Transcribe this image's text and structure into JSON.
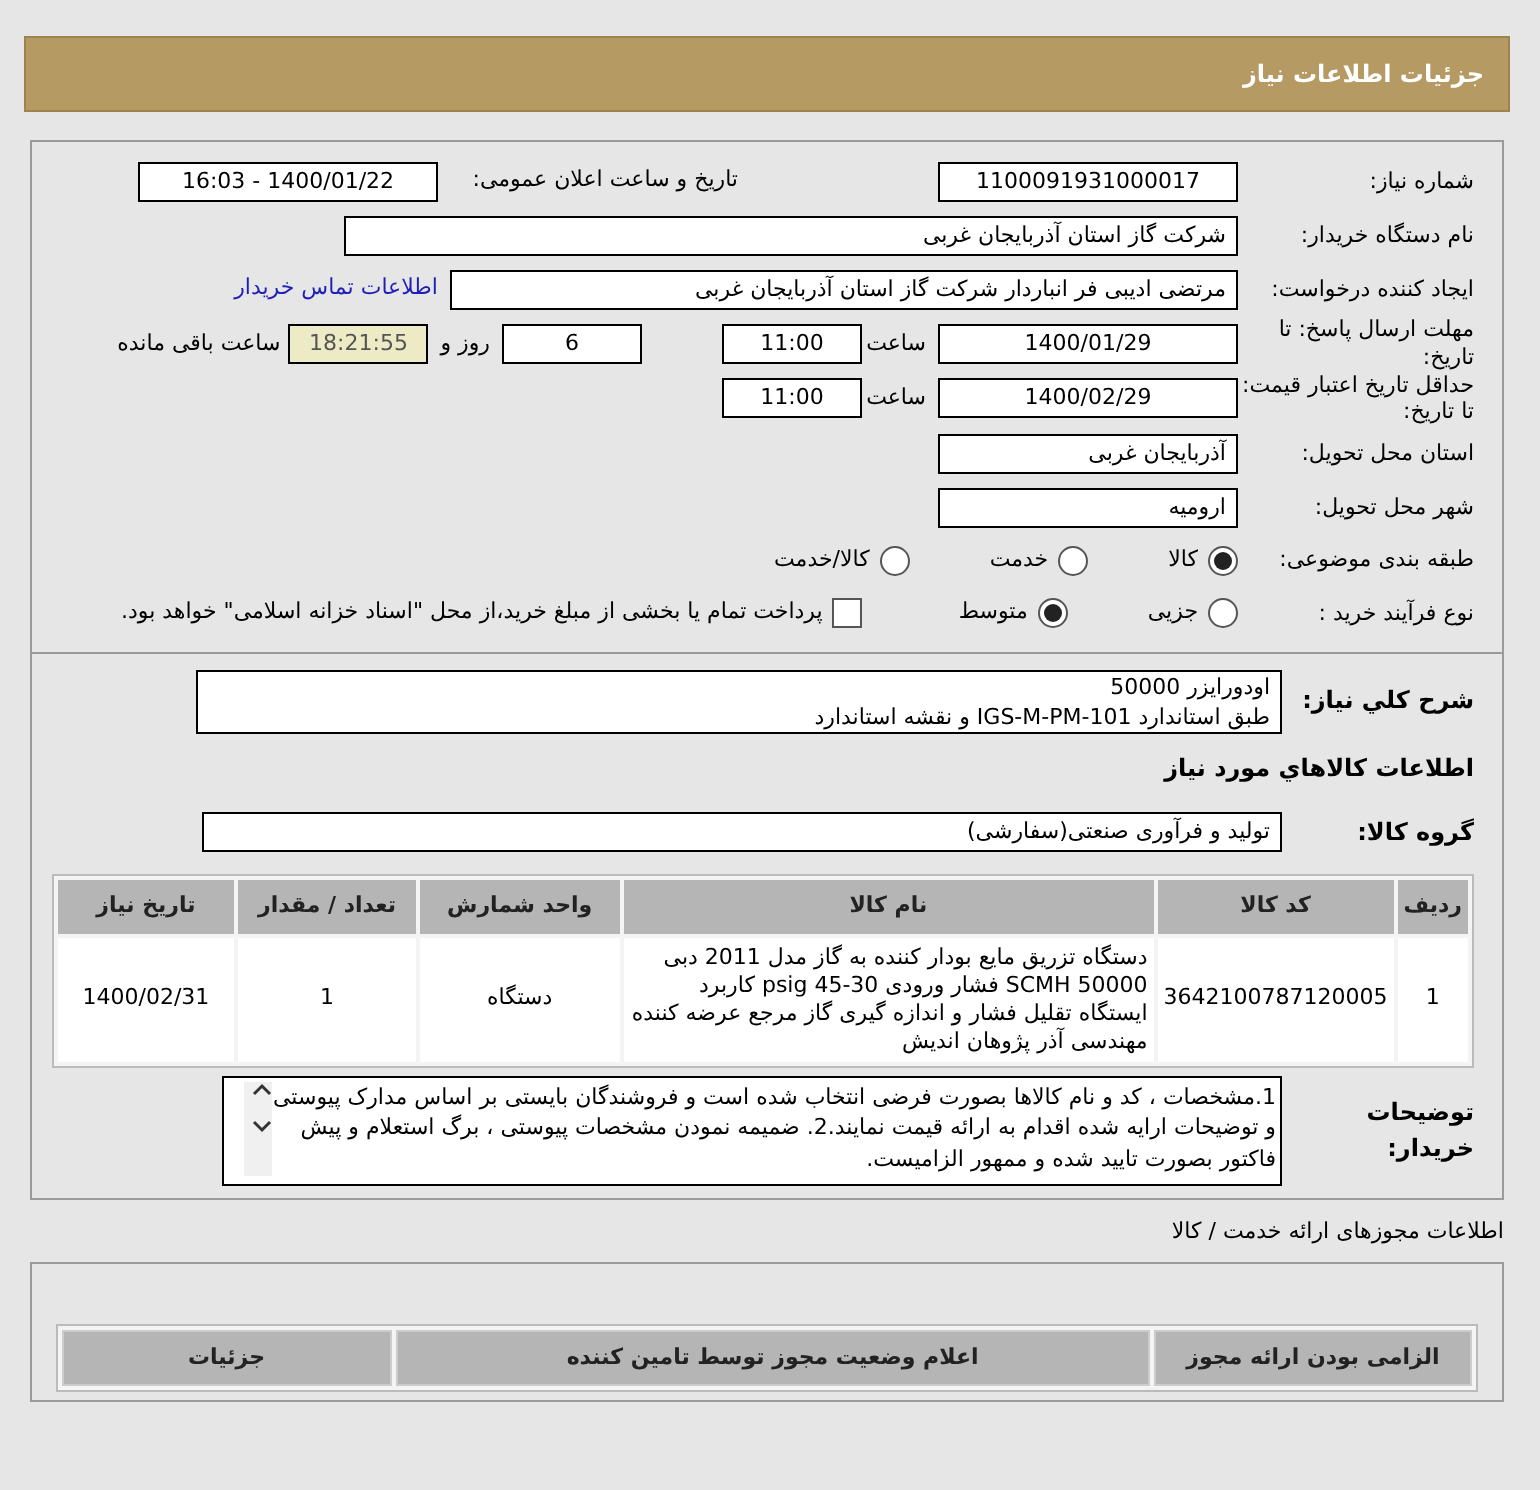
{
  "header": {
    "title": "جزئیات اطلاعات نیاز"
  },
  "need_number": {
    "label": "شماره نیاز:",
    "value": "1100091931000017"
  },
  "announce": {
    "label": "تاریخ و ساعت اعلان عمومی:",
    "value": "1400/01/22 - 16:03"
  },
  "buyer": {
    "label": "نام دستگاه خریدار:",
    "value": "شرکت گاز استان آذربایجان غربی"
  },
  "requester": {
    "label": "ایجاد کننده درخواست:",
    "value": "مرتضی ادیبی فر انباردار شرکت گاز استان آذربایجان غربی",
    "link": "اطلاعات تماس خریدار"
  },
  "deadline": {
    "label": "مهلت ارسال پاسخ: تا تاریخ:",
    "date": "1400/01/29",
    "time_label": "ساعت",
    "time": "11:00",
    "days": "6",
    "days_label": "روز و",
    "remaining": "18:21:55",
    "remaining_label": "ساعت باقی مانده"
  },
  "validity": {
    "label": "حداقل تاریخ اعتبار قیمت: تا تاریخ:",
    "date": "1400/02/29",
    "time_label": "ساعت",
    "time": "11:00"
  },
  "province": {
    "label": "استان محل تحویل:",
    "value": "آذربایجان غربی"
  },
  "city": {
    "label": "شهر محل تحویل:",
    "value": "ارومیه"
  },
  "category": {
    "label": "طبقه بندی موضوعی:",
    "options": [
      {
        "label": "کالا",
        "selected": true
      },
      {
        "label": "خدمت",
        "selected": false
      },
      {
        "label": "کالا/خدمت",
        "selected": false
      }
    ]
  },
  "process": {
    "label": "نوع فرآیند خرید :",
    "options": [
      {
        "label": "جزیی",
        "selected": false
      },
      {
        "label": "متوسط",
        "selected": true
      }
    ],
    "payment": {
      "label": "پرداخت تمام یا بخشی از مبلغ خرید،از محل \"اسناد خزانه اسلامی\" خواهد بود.",
      "checked": false
    }
  },
  "description": {
    "label": "شرح كلي نياز:",
    "lines": [
      "اودورایزر 50000",
      "طبق استاندارد IGS-M-PM-101 و نقشه استاندارد"
    ]
  },
  "goods_heading": "اطلاعات كالاهاي مورد نياز",
  "goods_group": {
    "label": "گروه کالا:",
    "value": "تولید و فرآوری صنعتی(سفارشی)"
  },
  "goods_table": {
    "columns": [
      "ردیف",
      "کد کالا",
      "نام کالا",
      "واحد شمارش",
      "تعداد / مقدار",
      "تاریخ نیاز"
    ],
    "rows": [
      [
        "1",
        "3642100787120005",
        "دستگاه تزریق مایع بودار کننده به گاز مدل 2011 دبی 50000 SCMH فشار ورودی psig 45-30 کاربرد ایستگاه تقلیل فشار و اندازه گیری گاز مرجع عرضه کننده مهندسی آذر پژوهان اندیش",
        "دستگاه",
        "1",
        "1400/02/31"
      ]
    ]
  },
  "buyer_notes": {
    "label": "توضیحات خریدار:",
    "value": "1.مشخصات ، کد و نام کالاها بصورت فرضی انتخاب شده است و فروشندگان بایستی بر اساس مدارک پیوستی و توضیحات ارایه شده اقدام به ارائه قیمت نمایند.2. ضمیمه نمودن مشخصات پیوستی ، برگ استعلام و پیش فاکتور بصورت تایید شده و ممهور الزامیست."
  },
  "licenses": {
    "title": "اطلاعات مجوزهای ارائه خدمت / کالا",
    "columns": [
      "الزامی بودن ارائه مجوز",
      "اعلام وضعیت مجوز توسط تامین کننده",
      "جزئیات"
    ]
  }
}
